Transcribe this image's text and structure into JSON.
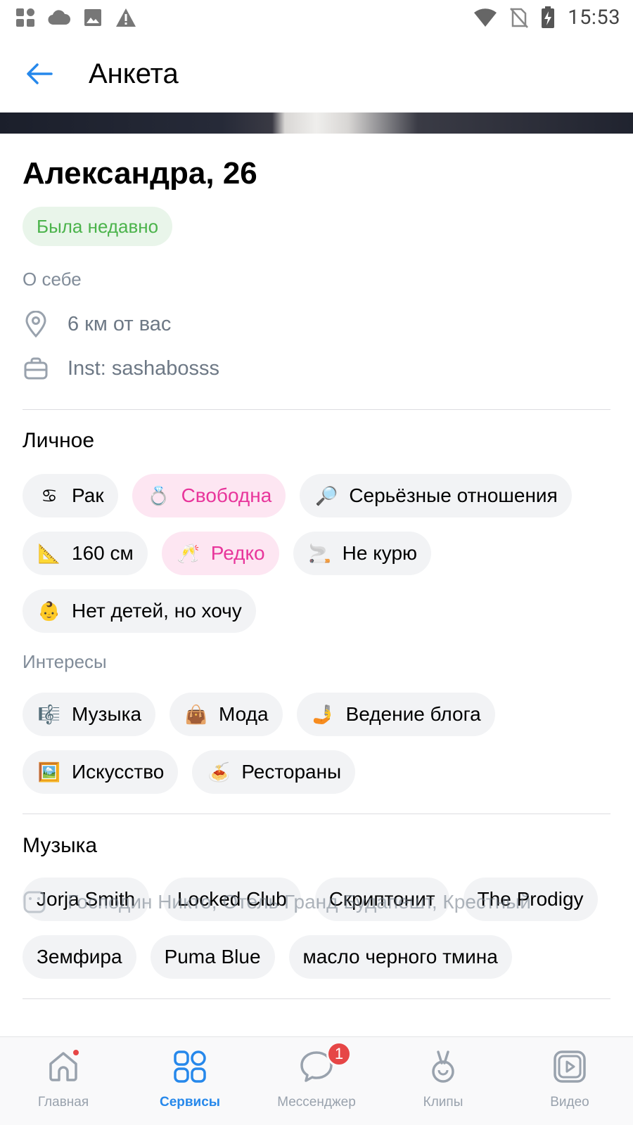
{
  "status_bar": {
    "time": "15:53",
    "icons": [
      "apps-icon",
      "cloud-icon",
      "image-icon",
      "warning-icon",
      "wifi-icon",
      "no-sim-icon",
      "battery-charging-icon"
    ]
  },
  "header": {
    "back_icon": "arrow-left-icon",
    "title": "Анкета"
  },
  "profile": {
    "name": "Александра, 26",
    "status": "Была недавно",
    "about_label": "О себе",
    "distance": "6 км от вас",
    "work": "Inst: sashabosss"
  },
  "personal": {
    "title": "Личное",
    "chips": [
      {
        "emoji": "♋",
        "label": "Рак",
        "highlight": false
      },
      {
        "emoji": "💍",
        "label": "Свободна",
        "highlight": true
      },
      {
        "emoji": "🔎",
        "label": "Серьёзные отношения",
        "highlight": false
      },
      {
        "emoji": "📐",
        "label": "160 см",
        "highlight": false
      },
      {
        "emoji": "🥂",
        "label": "Редко",
        "highlight": true
      },
      {
        "emoji": "🚬",
        "label": "Не курю",
        "highlight": false
      },
      {
        "emoji": "👶",
        "label": "Нет детей, но хочу",
        "highlight": false
      }
    ]
  },
  "interests": {
    "title": "Интересы",
    "chips": [
      {
        "emoji": "🎼",
        "label": "Музыка"
      },
      {
        "emoji": "👜",
        "label": "Мода"
      },
      {
        "emoji": "🤳",
        "label": "Ведение блога"
      },
      {
        "emoji": "🖼️",
        "label": "Искусство"
      },
      {
        "emoji": "🍝",
        "label": "Рестораны"
      }
    ]
  },
  "music": {
    "title": "Музыка",
    "chips": [
      "Jorja Smith",
      "Locked Club",
      "Скриптонит",
      "The Prodigy",
      "Земфира",
      "Puma Blue",
      "масло черного тмина"
    ]
  },
  "movies_row": {
    "text": "Господин Никто, Отель Гранд Будапешт, Крестный"
  },
  "bottom_nav": {
    "items": [
      {
        "label": "Главная",
        "icon": "home-icon",
        "active": false,
        "dot": true
      },
      {
        "label": "Сервисы",
        "icon": "services-icon",
        "active": true
      },
      {
        "label": "Мессенджер",
        "icon": "messenger-icon",
        "active": false,
        "badge": "1"
      },
      {
        "label": "Клипы",
        "icon": "clips-icon",
        "active": false
      },
      {
        "label": "Видео",
        "icon": "video-icon",
        "active": false
      }
    ]
  },
  "colors": {
    "accent": "#2688eb",
    "online_green": "#4bb34b",
    "pink": "#e8359b",
    "badge_red": "#e64646"
  }
}
